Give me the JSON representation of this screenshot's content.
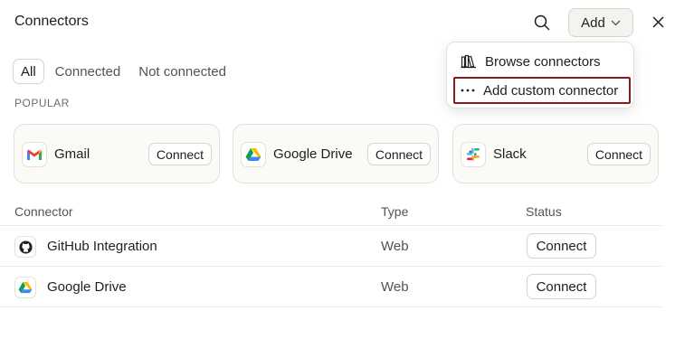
{
  "header": {
    "title": "Connectors",
    "add_label": "Add"
  },
  "tabs": [
    {
      "label": "All",
      "active": true
    },
    {
      "label": "Connected",
      "active": false
    },
    {
      "label": "Not connected",
      "active": false
    }
  ],
  "popular": {
    "label": "POPULAR",
    "cards": [
      {
        "name": "Gmail",
        "icon": "gmail-icon",
        "button": "Connect"
      },
      {
        "name": "Google Drive",
        "icon": "google-drive-icon",
        "button": "Connect"
      },
      {
        "name": "Slack",
        "icon": "slack-icon",
        "button": "Connect"
      }
    ]
  },
  "table": {
    "headers": {
      "connector": "Connector",
      "type": "Type",
      "status": "Status"
    },
    "rows": [
      {
        "name": "GitHub Integration",
        "icon": "github-icon",
        "type": "Web",
        "status_button": "Connect"
      },
      {
        "name": "Google Drive",
        "icon": "google-drive-icon",
        "type": "Web",
        "status_button": "Connect"
      }
    ]
  },
  "add_menu": {
    "items": [
      {
        "label": "Browse connectors",
        "icon": "library-icon"
      },
      {
        "label": "Add custom connector",
        "icon": "ellipsis-icon",
        "highlighted": true
      }
    ]
  },
  "colors": {
    "highlight_border": "#8b1a1a",
    "text": "#1f1e1d",
    "muted": "#55534e"
  }
}
